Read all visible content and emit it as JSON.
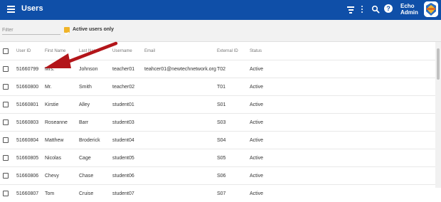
{
  "app": {
    "title": "Users"
  },
  "header": {
    "user_line1": "Echo",
    "user_line2": "Admin"
  },
  "filter": {
    "placeholder": "Filter",
    "active_only_label": "Active users only",
    "active_only_checked": true
  },
  "table": {
    "columns": [
      "User ID",
      "First Name",
      "Last Name",
      "Username",
      "Email",
      "External ID",
      "Status"
    ],
    "rows": [
      {
        "user_id": "51660799",
        "first": "Mrs.",
        "last": "Johnson",
        "username": "teacher01",
        "email": "teahcer01@newtechnetwork.org",
        "external_id": "T02",
        "status": "Active"
      },
      {
        "user_id": "51660800",
        "first": "Mr.",
        "last": "Smith",
        "username": "teacher02",
        "email": "",
        "external_id": "T01",
        "status": "Active"
      },
      {
        "user_id": "51660801",
        "first": "Kirstie",
        "last": "Alley",
        "username": "student01",
        "email": "",
        "external_id": "S01",
        "status": "Active"
      },
      {
        "user_id": "51660803",
        "first": "Roseanne",
        "last": "Barr",
        "username": "student03",
        "email": "",
        "external_id": "S03",
        "status": "Active"
      },
      {
        "user_id": "51660804",
        "first": "Matthew",
        "last": "Broderick",
        "username": "student04",
        "email": "",
        "external_id": "S04",
        "status": "Active"
      },
      {
        "user_id": "51660805",
        "first": "Nicolas",
        "last": "Cage",
        "username": "student05",
        "email": "",
        "external_id": "S05",
        "status": "Active"
      },
      {
        "user_id": "51660806",
        "first": "Chevy",
        "last": "Chase",
        "username": "student06",
        "email": "",
        "external_id": "S06",
        "status": "Active"
      },
      {
        "user_id": "51660807",
        "first": "Tom",
        "last": "Cruise",
        "username": "student07",
        "email": "",
        "external_id": "S07",
        "status": "Active"
      }
    ]
  },
  "colors": {
    "appbar": "#0f4fa8",
    "link": "#1a6fc4",
    "checkbox_checked": "#f0b429",
    "annotation_arrow": "#b3151a"
  },
  "icons": {
    "menu": "hamburger-icon",
    "filter": "filter-icon",
    "more": "more-vert-icon",
    "search": "search-icon",
    "help": "help-icon",
    "logo": "logo-icon"
  }
}
